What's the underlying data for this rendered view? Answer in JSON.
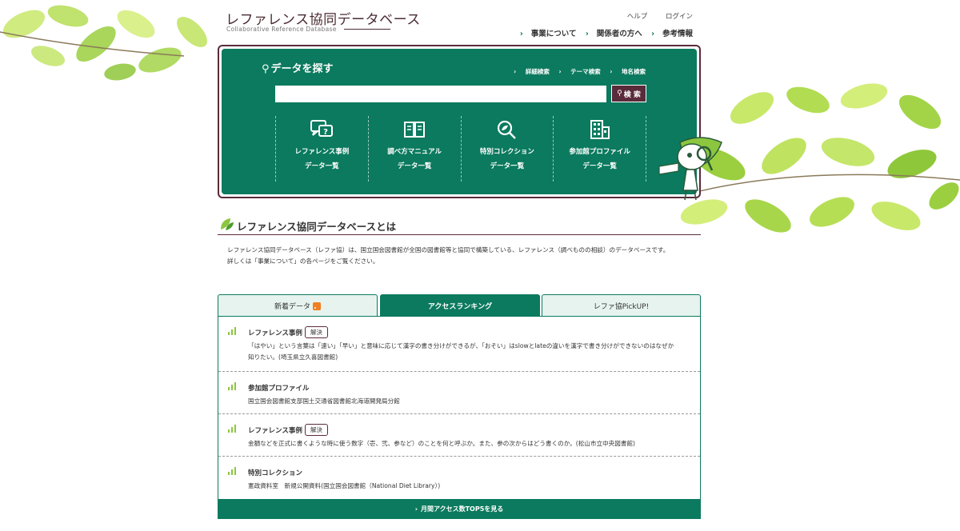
{
  "site": {
    "title": "レファレンス協同データベース",
    "subtitle": "Collaborative Reference Database"
  },
  "top_links": {
    "help": "ヘルプ",
    "login": "ログイン"
  },
  "main_nav": [
    {
      "label": "事業について"
    },
    {
      "label": "関係者の方へ"
    },
    {
      "label": "参考情報"
    }
  ],
  "search": {
    "heading": "データを探す",
    "sublinks": [
      {
        "label": "詳細検索"
      },
      {
        "label": "テーマ検索"
      },
      {
        "label": "地名検索"
      }
    ],
    "input_value": "",
    "button_label": "検 索"
  },
  "categories": [
    {
      "line1": "レファレンス事例",
      "line2": "データ一覧",
      "icon": "chat-question-icon"
    },
    {
      "line1": "調べ方マニュアル",
      "line2": "データ一覧",
      "icon": "book-icon"
    },
    {
      "line1": "特別コレクション",
      "line2": "データ一覧",
      "icon": "magnifier-leaf-icon"
    },
    {
      "line1": "参加館プロファイル",
      "line2": "データ一覧",
      "icon": "building-icon"
    }
  ],
  "about": {
    "title": "レファレンス協同データベースとは",
    "line1": "レファレンス協同データベース（レファ協）は、国立国会図書館が全国の図書館等と協同で構築している、レファレンス（調べものの相談）のデータベースです。",
    "line2": "詳しくは「事業について」の各ページをご覧ください。"
  },
  "tabs": [
    {
      "label": "新着データ",
      "active": false
    },
    {
      "label": "アクセスランキング",
      "active": true
    },
    {
      "label": "レファ協PickUP!",
      "active": false
    }
  ],
  "ranking": [
    {
      "category": "レファレンス事例",
      "badge": "解決",
      "line1": "「はやい」という言葉は「速い」「早い」と意味に応じて漢字の書き分けができるが、「おそい」はslowとlateの違いを漢字で書き分けができないのはなぜか",
      "line2": "知りたい。(埼玉県立久喜図書館)"
    },
    {
      "category": "参加館プロファイル",
      "badge": "",
      "line1": "国立国会図書館支部国土交通省図書館北海道開発局分館",
      "line2": ""
    },
    {
      "category": "レファレンス事例",
      "badge": "解決",
      "line1": "金額などを正式に書くような時に使う数字（壱、弐、参など）のことを何と呼ぶか。また、参の次からはどう書くのか。(松山市立中央図書館)",
      "line2": ""
    },
    {
      "category": "特別コレクション",
      "badge": "",
      "line1": "憲政資料室　新規公開資料(国立国会図書館（National Diet Library）)",
      "line2": ""
    }
  ],
  "more_label": "月間アクセス数TOP5を見る",
  "colors": {
    "primary": "#0b7a5e",
    "accent": "#5a2b3a",
    "leaf": "#8cc63f"
  }
}
